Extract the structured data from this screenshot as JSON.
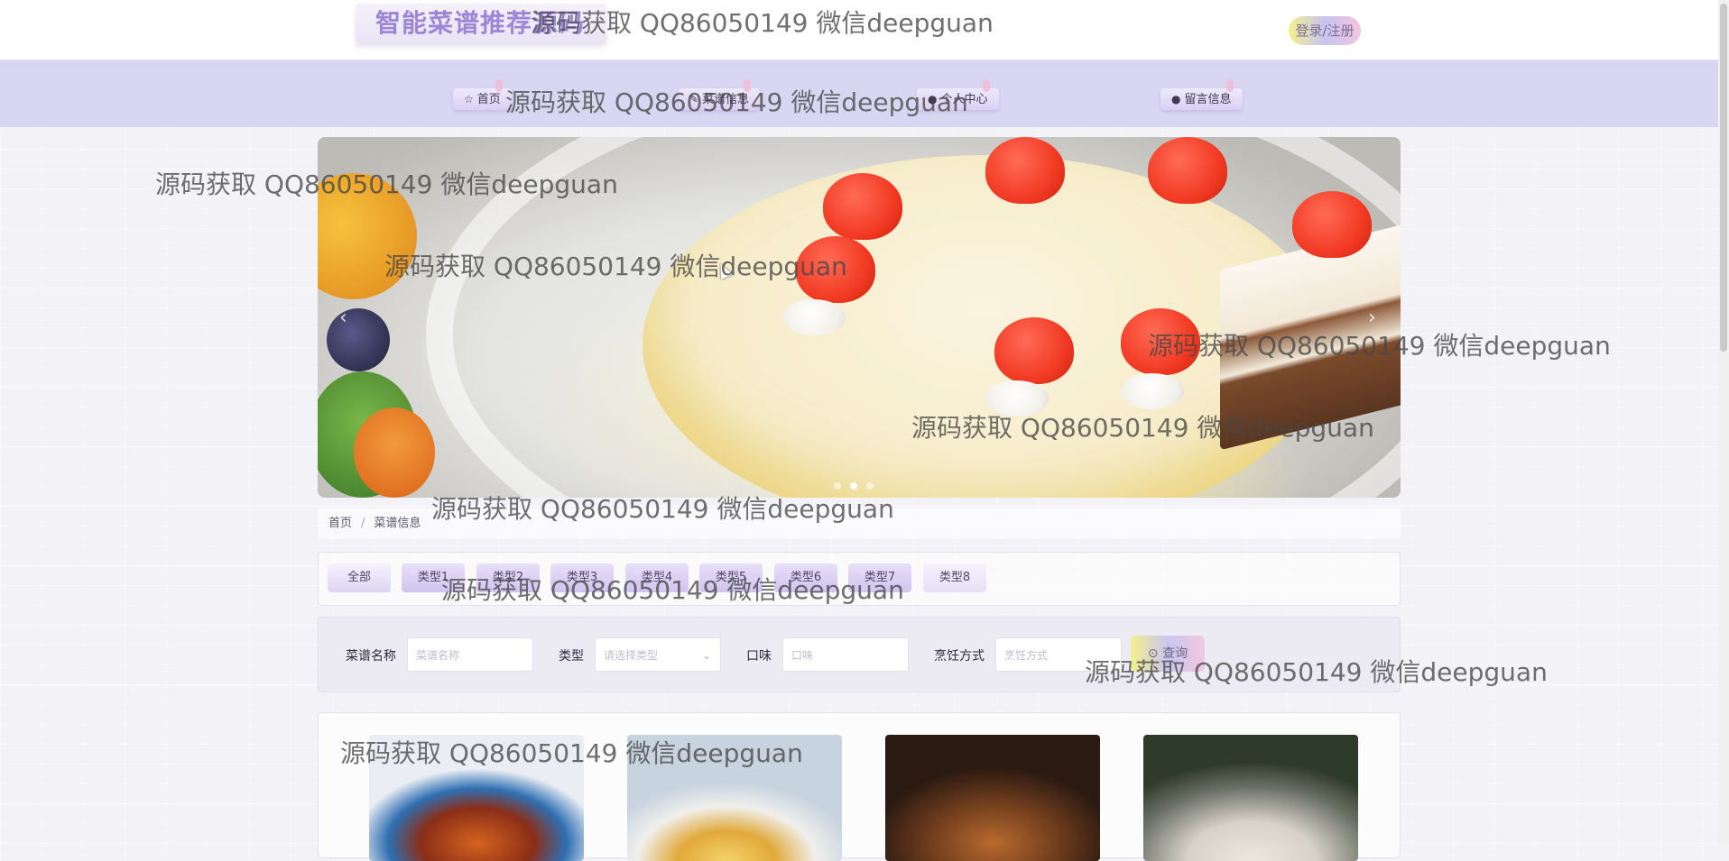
{
  "header": {
    "brand": "智能菜谱推荐源码",
    "login_label": "登录/注册"
  },
  "nav": {
    "items": [
      {
        "icon": "home-icon",
        "glyph": "☆",
        "label": "首页"
      },
      {
        "icon": "recipe-icon",
        "glyph": "✎",
        "label": "菜谱信息"
      },
      {
        "icon": "user-icon",
        "glyph": "●",
        "label": "个人中心"
      },
      {
        "icon": "message-icon",
        "glyph": "●",
        "label": "留言信息"
      }
    ]
  },
  "banner": {
    "prev_glyph": "‹",
    "next_glyph": "›",
    "slide_count": 3,
    "active_slide": 2
  },
  "breadcrumb": {
    "home": "首页",
    "separator": "/",
    "current": "菜谱信息"
  },
  "categories": [
    "全部",
    "类型1",
    "类型2",
    "类型3",
    "类型4",
    "类型5",
    "类型6",
    "类型7",
    "类型8"
  ],
  "search": {
    "name_label": "菜谱名称",
    "name_placeholder": "菜谱名称",
    "type_label": "类型",
    "type_placeholder": "请选择类型",
    "taste_label": "口味",
    "taste_placeholder": "口味",
    "cook_label": "烹饪方式",
    "cook_placeholder": "烹饪方式",
    "query_label": "查询",
    "query_glyph": "⊙"
  },
  "watermark": "源码获取 QQ86050149 微信deepguan",
  "colors": {
    "nav_bg": "#d8d6f2",
    "brand_text": "#9c86d6",
    "accent_gradient": [
      "#f2ef8c",
      "#c9c6f1",
      "#f2c6df"
    ]
  }
}
